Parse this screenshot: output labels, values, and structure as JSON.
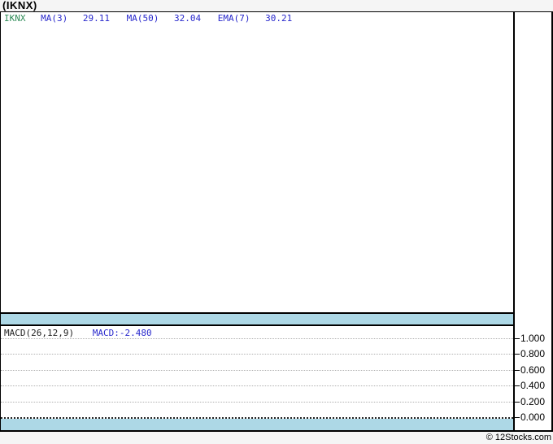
{
  "header": {
    "title": "(IKNX)"
  },
  "price_panel": {
    "legend": {
      "symbol": "IKNX",
      "indicators": [
        {
          "label": "MA(3)",
          "value": "29.11"
        },
        {
          "label": "MA(50)",
          "value": "32.04"
        },
        {
          "label": "EMA(7)",
          "value": "30.21"
        }
      ]
    }
  },
  "macd_panel": {
    "legend": {
      "label": "MACD(26,12,9)",
      "value": "MACD:-2.480"
    },
    "yticks": [
      "1.000",
      "0.800",
      "0.600",
      "0.400",
      "0.200",
      "0.000"
    ]
  },
  "footer": {
    "copyright": "© 12Stocks.com"
  },
  "colors": {
    "highlight_band": "#ADD8E6",
    "legend_symbol_green": "#2E8B57",
    "legend_indicator_blue": "#2828CC",
    "page_background": "#F5F5F5",
    "panel_background": "#FFFFFF",
    "border_black": "#000000",
    "gridline_gray": "#B0B0B0"
  },
  "chart_data": {
    "type": "line",
    "title": "(IKNX)",
    "legend_position": "top-left",
    "panels": [
      {
        "name": "price",
        "symbol": "IKNX",
        "indicators": [
          {
            "name": "MA(3)",
            "value": 29.11
          },
          {
            "name": "MA(50)",
            "value": 32.04
          },
          {
            "name": "EMA(7)",
            "value": 30.21
          }
        ],
        "series": [],
        "note": "no price data plotted in visible range"
      },
      {
        "name": "macd",
        "indicator": "MACD(26,12,9)",
        "current_value": -2.48,
        "yticks": [
          1.0,
          0.8,
          0.6,
          0.4,
          0.2,
          0.0
        ],
        "ylim": [
          0.0,
          1.08
        ],
        "grid": "dotted horizontal gridlines, dense dotted zero line",
        "series": [],
        "note": "no MACD series plotted in visible range"
      }
    ]
  }
}
